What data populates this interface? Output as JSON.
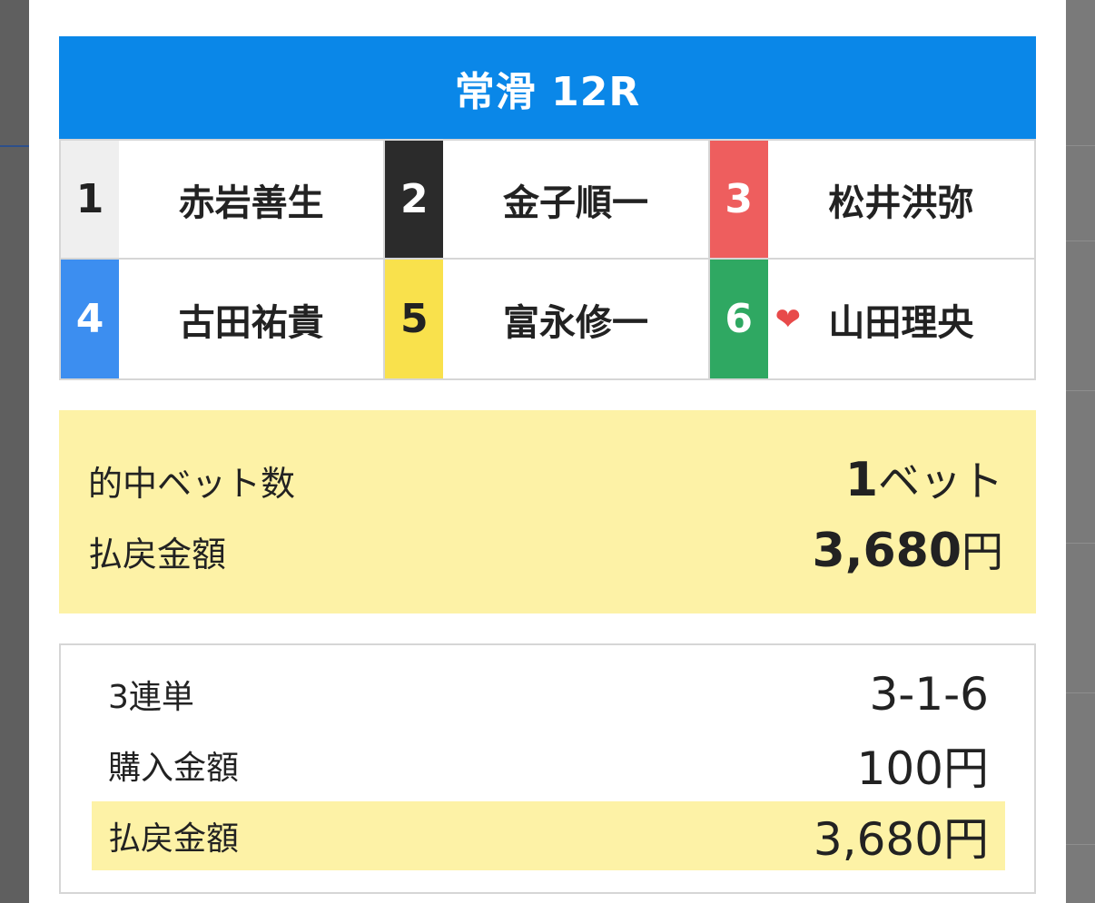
{
  "race": {
    "title": "常滑 12R"
  },
  "entries": [
    {
      "lane": "1",
      "name": "赤岩善生",
      "bg": "#efefef",
      "fg": "#222222",
      "favorite": false
    },
    {
      "lane": "2",
      "name": "金子順一",
      "bg": "#2b2b2b",
      "fg": "#ffffff",
      "favorite": false
    },
    {
      "lane": "3",
      "name": "松井洪弥",
      "bg": "#ee5e5e",
      "fg": "#ffffff",
      "favorite": false
    },
    {
      "lane": "4",
      "name": "古田祐貴",
      "bg": "#3c8ef0",
      "fg": "#ffffff",
      "favorite": false
    },
    {
      "lane": "5",
      "name": "富永修一",
      "bg": "#f9e14c",
      "fg": "#222222",
      "favorite": false
    },
    {
      "lane": "6",
      "name": "山田理央",
      "bg": "#2fa862",
      "fg": "#ffffff",
      "favorite": true
    }
  ],
  "summary": {
    "hit_label": "的中ベット数",
    "hit_value": "1",
    "hit_unit": "ベット",
    "payout_label": "払戻金額",
    "payout_value": "3,680",
    "payout_unit": "円"
  },
  "detail": {
    "bet_type_label": "3連単",
    "bet_type_value": "3-1-6",
    "purchase_label": "購入金額",
    "purchase_value": "100円",
    "payout_label": "払戻金額",
    "payout_value": "3,680円"
  },
  "icons": {
    "favorite": "heart-icon"
  },
  "colors": {
    "header": "#0a87e8",
    "highlight": "#fdf2a6",
    "heart": "#e84a4a"
  }
}
